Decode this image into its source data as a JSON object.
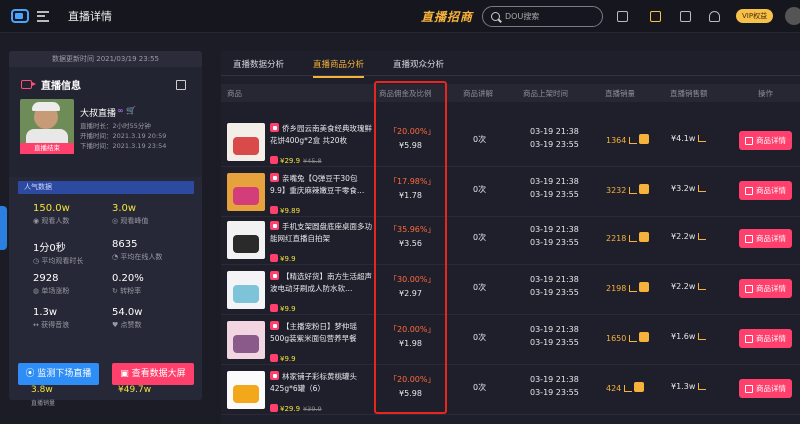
{
  "header": {
    "page_title": "直播详情",
    "brand": "直播招商",
    "search_placeholder": "DOU搜索",
    "vip_label": "VIP权益"
  },
  "left_panel": {
    "update_time": "数据更新时间 2021/03/19 23:55",
    "section_title": "直播信息",
    "anchor_name": "大叔直播",
    "live_end_tag": "直播结束",
    "live_duration": "直播时长：2小时55分钟",
    "start_time": "开播时间：2021.3.19 20:59",
    "end_time": "下播时间：2021.3.19 23:54",
    "popularity_title": "人气数据",
    "stats": [
      {
        "value": "150.0w",
        "label": "观看人数"
      },
      {
        "value": "3.0w",
        "label": "观看峰值"
      },
      {
        "value": "1分0秒",
        "label": "平均观看时长"
      },
      {
        "value": "8635",
        "label": "平均在线人数"
      },
      {
        "value": "2928",
        "label": "单场涨粉"
      },
      {
        "value": "0.20%",
        "label": "转粉率"
      },
      {
        "value": "1.3w",
        "label": "获得音浪"
      },
      {
        "value": "54.0w",
        "label": "点赞数"
      }
    ],
    "btn_monitor": "监测下场直播",
    "btn_screen": "查看数据大屏",
    "peek_values": [
      "3.8w",
      "¥49.7w"
    ],
    "peek_label": "直播销量"
  },
  "tabs": [
    "直播数据分析",
    "直播商品分析",
    "直播观众分析"
  ],
  "active_tab": 1,
  "table": {
    "headers": [
      "商品",
      "商品佣金及比例",
      "商品讲解",
      "商品上架时间",
      "直播销量",
      "直播销售额",
      "操作"
    ],
    "detail_label": "商品详情",
    "rows": [
      {
        "title": "侨乡园云南美食经典玫瑰鲜花饼400g*2盒 共20枚",
        "price": "¥29.9",
        "orig": "¥45.8",
        "pct": "「20.00%」",
        "comm": "¥5.98",
        "expl": "0次",
        "t1": "03-19 21:38",
        "t2": "03-19 23:55",
        "sales": "1364",
        "amount": "¥4.1w",
        "thumb": [
          "#f4eee8",
          "#d94a4a"
        ]
      },
      {
        "title": "亲嘴兔【Q弹豆干30包9.9】重庆麻辣嫩豆干零食…",
        "price": "¥9.89",
        "orig": "",
        "pct": "「17.98%」",
        "comm": "¥1.78",
        "expl": "0次",
        "t1": "03-19 21:38",
        "t2": "03-19 23:55",
        "sales": "3232",
        "amount": "¥3.2w",
        "thumb": [
          "#e6a23c",
          "#d33e7a"
        ]
      },
      {
        "title": "手机支架圆盘底座桌面多功能网红直播自拍架",
        "price": "¥9.9",
        "orig": "",
        "pct": "「35.96%」",
        "comm": "¥3.56",
        "expl": "0次",
        "t1": "03-19 21:38",
        "t2": "03-19 23:55",
        "sales": "2218",
        "amount": "¥2.2w",
        "thumb": [
          "#f2f2f2",
          "#2a2a2a"
        ]
      },
      {
        "title": "【精选好货】南方生活超声波电动牙刷成人防水软…",
        "price": "¥9.9",
        "orig": "",
        "pct": "「30.00%」",
        "comm": "¥2.97",
        "expl": "0次",
        "t1": "03-19 21:38",
        "t2": "03-19 23:55",
        "sales": "2198",
        "amount": "¥2.2w",
        "thumb": [
          "#f4f4f6",
          "#7ec4d8"
        ]
      },
      {
        "title": "【主播宠粉日】梦仲瑶500g装紫米面包营养早餐",
        "price": "¥9.9",
        "orig": "",
        "pct": "「20.00%」",
        "comm": "¥1.98",
        "expl": "0次",
        "t1": "03-19 21:38",
        "t2": "03-19 23:55",
        "sales": "1650",
        "amount": "¥1.6w",
        "thumb": [
          "#f1d6e2",
          "#8a5a8a"
        ]
      },
      {
        "title": "林家铺子彩标黄桃罐头425g*6罐（6）",
        "price": "¥29.9",
        "orig": "¥39.9",
        "pct": "「20.00%」",
        "comm": "¥5.98",
        "expl": "0次",
        "t1": "03-19 21:38",
        "t2": "03-19 23:55",
        "sales": "424",
        "amount": "¥1.3w",
        "thumb": [
          "#fbfbfb",
          "#f2a81a"
        ]
      }
    ]
  }
}
